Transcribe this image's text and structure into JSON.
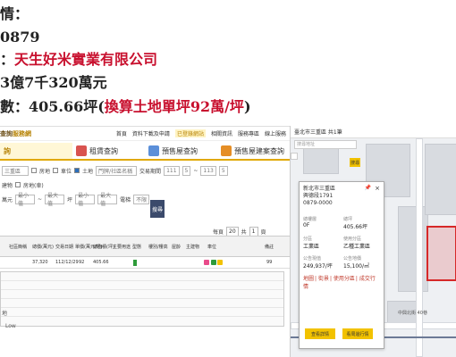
{
  "caption": {
    "line1": "情：",
    "line2": "0879",
    "line3_prefix": "：",
    "line3_buyer": "天生好米實業有限公司",
    "line4": "3億7千320萬元",
    "line5_prefix": "數：405.66坪(",
    "line5_red": "換算土地單坪92萬/坪",
    "line5_suffix": ")"
  },
  "left": {
    "logo_a": "查詢",
    "logo_b": "服務網",
    "toplinks": [
      "首頁",
      "資料下載及申請",
      "已登錄網站",
      "相關資訊",
      "服務專區",
      "線上服務"
    ],
    "tabs": [
      "詢",
      "租賃查詢",
      "預售屋查詢",
      "預售屋建案查詢"
    ],
    "filters": {
      "city": "三重區",
      "opt1": "房地",
      "opt2": "車位",
      "opt3": "房地(車)",
      "opt4": "土地",
      "opt5": "建物",
      "addr_placeholder": "門牌/社區名稱",
      "date_label": "交易期間",
      "y1": "111",
      "m1": "5",
      "y2": "113",
      "m2": "5",
      "to": "~",
      "unit": "萬元",
      "min": "最小值",
      "max": "最大值",
      "ping": "坪",
      "age_min": "最小值",
      "age_max": "最大值",
      "elevator": "電梯",
      "unlimited": "不限",
      "query": "搜尋"
    },
    "pager": {
      "label": "每頁",
      "count": "20",
      "page_label": "頁",
      "page": "1",
      "of": "共"
    },
    "header": [
      "社區簡稱",
      "總價(萬元)",
      "交易日期",
      "單價(萬元/坪)",
      "總面積(坪)",
      "主要用途",
      "型態",
      "樓別/樓高",
      "屋齡",
      "主建物",
      "車位",
      "備註"
    ],
    "row": {
      "price": "37,320",
      "date": "112/12/29",
      "unit": "92",
      "area": "405.66",
      "note": "99"
    },
    "side_marks": [
      "地",
      "Low"
    ]
  },
  "right": {
    "title": "臺北市三重區 共1筆",
    "search_placeholder": "搜尋地址",
    "pin_label": "搜尋",
    "popup": {
      "title1": "新北市三重區",
      "title2": "興德段1791",
      "title3": "0879-0000",
      "k1": "總樓層",
      "v1": "0F",
      "k2": "總坪",
      "v2": "405.66坪",
      "k3": "分區",
      "v3": "工業區",
      "k4": "使用分區",
      "v4": "乙種工業區",
      "k5": "公告現值",
      "v5": "249,937/坪",
      "k6": "公告地價",
      "v6": "15,100/㎡",
      "links": [
        "地圖",
        "街景",
        "使用分區",
        "成交行情"
      ],
      "btn1": "查看詳情",
      "btn2": "看周邊行情"
    },
    "street": "中興北街 40巷"
  }
}
